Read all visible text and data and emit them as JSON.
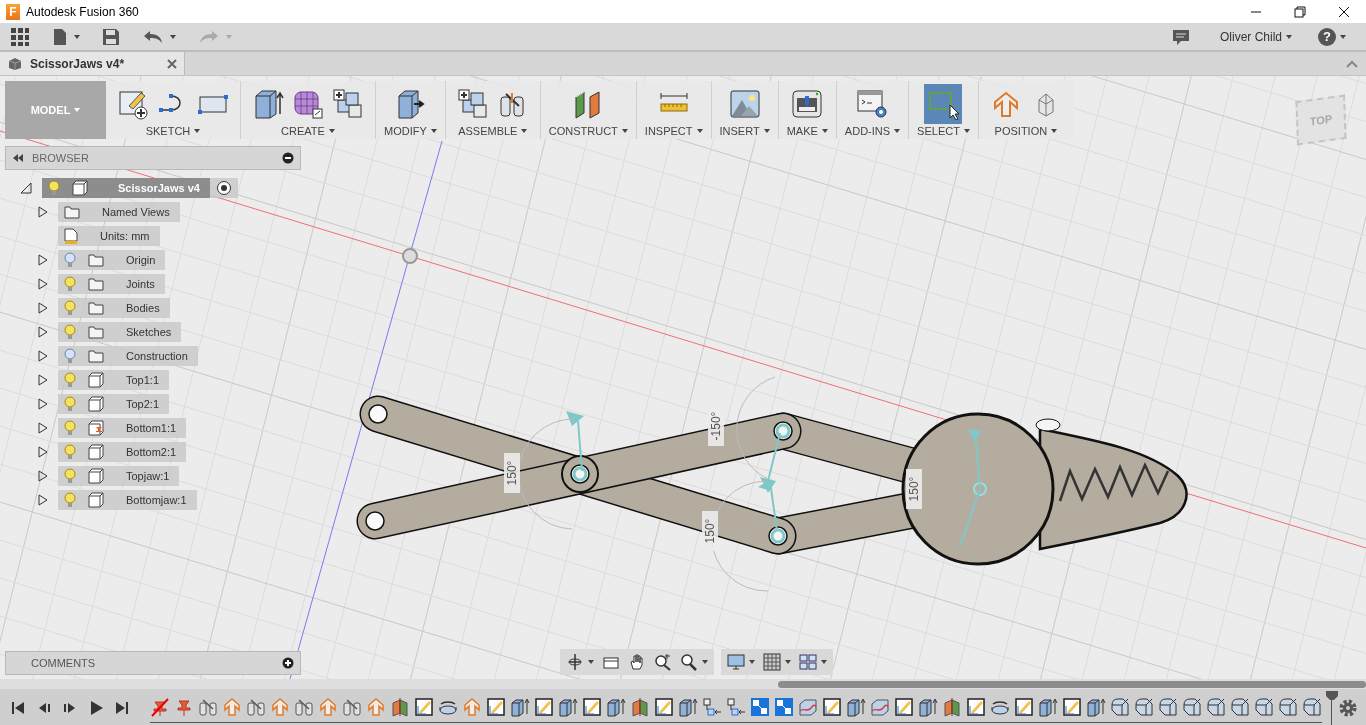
{
  "window": {
    "logo_letter": "F",
    "title": "Autodesk Fusion 360"
  },
  "quick_access": {
    "user": "Oliver Child",
    "help": "?"
  },
  "document_tab": {
    "title": "ScissorJaws v4*",
    "selected": true
  },
  "toolbar": {
    "workspace": "MODEL",
    "groups": [
      {
        "label": "SKETCH",
        "selected": false,
        "tools": [
          {
            "kind": "sketch"
          },
          {
            "kind": "spline"
          },
          {
            "kind": "rectangle"
          }
        ]
      },
      {
        "label": "CREATE",
        "selected": false,
        "tools": [
          {
            "kind": "extrude"
          },
          {
            "kind": "form"
          },
          {
            "kind": "new-component"
          }
        ]
      },
      {
        "label": "MODIFY",
        "selected": false,
        "tools": [
          {
            "kind": "press-pull"
          }
        ]
      },
      {
        "label": "ASSEMBLE",
        "selected": false,
        "tools": [
          {
            "kind": "new-component"
          },
          {
            "kind": "joint"
          }
        ]
      },
      {
        "label": "CONSTRUCT",
        "selected": false,
        "tools": [
          {
            "kind": "plane"
          }
        ]
      },
      {
        "label": "INSPECT",
        "selected": false,
        "tools": [
          {
            "kind": "measure"
          }
        ]
      },
      {
        "label": "INSERT",
        "selected": false,
        "tools": [
          {
            "kind": "image"
          }
        ]
      },
      {
        "label": "MAKE",
        "selected": false,
        "tools": [
          {
            "kind": "printer"
          }
        ]
      },
      {
        "label": "ADD-INS",
        "selected": false,
        "tools": [
          {
            "kind": "scripts"
          }
        ]
      },
      {
        "label": "SELECT",
        "selected": true,
        "tools": [
          {
            "kind": "select"
          }
        ]
      },
      {
        "label": "POSITION",
        "selected": false,
        "tools": [
          {
            "kind": "capture"
          },
          {
            "kind": "revert"
          }
        ]
      }
    ]
  },
  "browser": {
    "title": "BROWSER",
    "root": {
      "label": "ScissorJaws v4",
      "visible": true,
      "expanded": true,
      "active": true,
      "children": [
        {
          "label": "Named Views",
          "kind": "views",
          "expanded": false
        },
        {
          "label": "Units: mm",
          "kind": "units"
        },
        {
          "label": "Origin",
          "kind": "folder",
          "visible": false,
          "expanded": false
        },
        {
          "label": "Joints",
          "kind": "folder",
          "visible": true,
          "expanded": false
        },
        {
          "label": "Bodies",
          "kind": "folder",
          "visible": true,
          "expanded": false
        },
        {
          "label": "Sketches",
          "kind": "folder",
          "visible": true,
          "expanded": false
        },
        {
          "label": "Construction",
          "kind": "folder",
          "visible": false,
          "expanded": false
        },
        {
          "label": "Top1:1",
          "kind": "component",
          "visible": true,
          "expanded": false
        },
        {
          "label": "Top2:1",
          "kind": "component",
          "visible": true,
          "expanded": false
        },
        {
          "label": "Bottom1:1",
          "kind": "grounded-component",
          "visible": true,
          "expanded": false
        },
        {
          "label": "Bottom2:1",
          "kind": "component",
          "visible": true,
          "expanded": false
        },
        {
          "label": "Topjaw:1",
          "kind": "component",
          "visible": true,
          "expanded": false
        },
        {
          "label": "Bottomjaw:1",
          "kind": "component",
          "visible": true,
          "expanded": false
        }
      ]
    }
  },
  "viewport": {
    "view_cube": "TOP",
    "angle_labels": [
      "150°",
      "-150°",
      "150°",
      "150°"
    ]
  },
  "comments": {
    "title": "COMMENTS"
  },
  "timeline": {
    "features": [
      {
        "kind": "pin-crossed"
      },
      {
        "kind": "pin"
      },
      {
        "kind": "joint"
      },
      {
        "kind": "move"
      },
      {
        "kind": "joint"
      },
      {
        "kind": "move"
      },
      {
        "kind": "joint"
      },
      {
        "kind": "move"
      },
      {
        "kind": "joint"
      },
      {
        "kind": "move"
      },
      {
        "kind": "split"
      },
      {
        "kind": "sketch"
      },
      {
        "kind": "revolve"
      },
      {
        "kind": "move"
      },
      {
        "kind": "sketch"
      },
      {
        "kind": "extrude"
      },
      {
        "kind": "sketch"
      },
      {
        "kind": "extrude"
      },
      {
        "kind": "sketch"
      },
      {
        "kind": "extrude"
      },
      {
        "kind": "split"
      },
      {
        "kind": "sketch"
      },
      {
        "kind": "extrude"
      },
      {
        "kind": "align"
      },
      {
        "kind": "align"
      },
      {
        "kind": "pattern"
      },
      {
        "kind": "pattern"
      },
      {
        "kind": "surface"
      },
      {
        "kind": "sketch"
      },
      {
        "kind": "extrude"
      },
      {
        "kind": "surface"
      },
      {
        "kind": "sketch"
      },
      {
        "kind": "extrude"
      },
      {
        "kind": "split"
      },
      {
        "kind": "sketch"
      },
      {
        "kind": "revolve"
      },
      {
        "kind": "sketch"
      },
      {
        "kind": "extrude"
      },
      {
        "kind": "sketch"
      },
      {
        "kind": "extrude"
      },
      {
        "kind": "fillet"
      },
      {
        "kind": "fillet"
      },
      {
        "kind": "fillet"
      },
      {
        "kind": "fillet"
      },
      {
        "kind": "fillet"
      },
      {
        "kind": "fillet"
      },
      {
        "kind": "fillet"
      },
      {
        "kind": "fillet"
      },
      {
        "kind": "fillet"
      }
    ]
  }
}
